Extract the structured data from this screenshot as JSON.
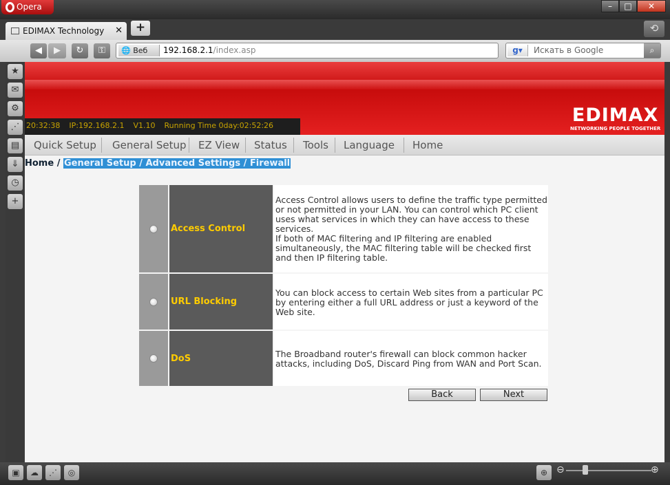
{
  "browser": {
    "app_name": "Opera",
    "tab_title": "EDIMAX Technology",
    "address_prefix": "Веб",
    "url_host": "192.168.2.1",
    "url_path": "/index.asp",
    "search_placeholder": "Искать в Google",
    "search_engine_icon": "g-icon"
  },
  "router": {
    "info": {
      "time": "20:32:38",
      "ip": "IP:192.168.2.1",
      "version": "V1.10",
      "running_time": "Running Time 0day:02:52:26"
    },
    "logo": {
      "name": "EDIMAX",
      "tagline": "NETWORKING PEOPLE TOGETHER"
    },
    "menu": [
      "Quick Setup",
      "General Setup",
      "EZ View",
      "Status",
      "Tools",
      "Language",
      "Home"
    ],
    "breadcrumb": {
      "home": "Home",
      "separator": "/",
      "path": "General Setup / Advanced Settings / Firewall"
    },
    "options": [
      {
        "label": "Access Control",
        "description": "Access Control allows users to define the traffic type permitted or not permitted in your LAN. You can control which PC client uses what services in which they can have access to these services.",
        "description2": "If both of MAC filtering and IP filtering are enabled simultaneously, the MAC filtering table will be checked first and then IP filtering table."
      },
      {
        "label": "URL Blocking",
        "description": "You can block access to certain Web sites from a particular PC by entering either a full URL address or just a keyword of the Web site."
      },
      {
        "label": "DoS",
        "description": "The Broadband router's firewall can block common hacker attacks, including DoS, Discard Ping from WAN and Port Scan."
      }
    ],
    "buttons": {
      "back": "Back",
      "next": "Next"
    }
  },
  "colors": {
    "banner_red": "#d51212",
    "label_yellow": "#ffcc00",
    "info_text": "#c9a400",
    "breadcrumb_highlight": "#2f8fd5"
  }
}
